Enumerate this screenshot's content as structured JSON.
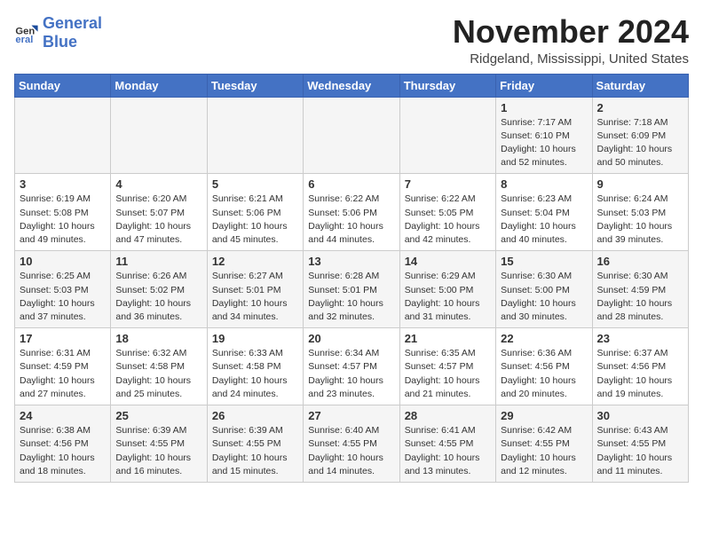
{
  "header": {
    "logo_general": "General",
    "logo_blue": "Blue",
    "month_title": "November 2024",
    "location": "Ridgeland, Mississippi, United States"
  },
  "calendar": {
    "days_of_week": [
      "Sunday",
      "Monday",
      "Tuesday",
      "Wednesday",
      "Thursday",
      "Friday",
      "Saturday"
    ],
    "weeks": [
      [
        {
          "day": "",
          "info": ""
        },
        {
          "day": "",
          "info": ""
        },
        {
          "day": "",
          "info": ""
        },
        {
          "day": "",
          "info": ""
        },
        {
          "day": "",
          "info": ""
        },
        {
          "day": "1",
          "info": "Sunrise: 7:17 AM\nSunset: 6:10 PM\nDaylight: 10 hours\nand 52 minutes."
        },
        {
          "day": "2",
          "info": "Sunrise: 7:18 AM\nSunset: 6:09 PM\nDaylight: 10 hours\nand 50 minutes."
        }
      ],
      [
        {
          "day": "3",
          "info": "Sunrise: 6:19 AM\nSunset: 5:08 PM\nDaylight: 10 hours\nand 49 minutes."
        },
        {
          "day": "4",
          "info": "Sunrise: 6:20 AM\nSunset: 5:07 PM\nDaylight: 10 hours\nand 47 minutes."
        },
        {
          "day": "5",
          "info": "Sunrise: 6:21 AM\nSunset: 5:06 PM\nDaylight: 10 hours\nand 45 minutes."
        },
        {
          "day": "6",
          "info": "Sunrise: 6:22 AM\nSunset: 5:06 PM\nDaylight: 10 hours\nand 44 minutes."
        },
        {
          "day": "7",
          "info": "Sunrise: 6:22 AM\nSunset: 5:05 PM\nDaylight: 10 hours\nand 42 minutes."
        },
        {
          "day": "8",
          "info": "Sunrise: 6:23 AM\nSunset: 5:04 PM\nDaylight: 10 hours\nand 40 minutes."
        },
        {
          "day": "9",
          "info": "Sunrise: 6:24 AM\nSunset: 5:03 PM\nDaylight: 10 hours\nand 39 minutes."
        }
      ],
      [
        {
          "day": "10",
          "info": "Sunrise: 6:25 AM\nSunset: 5:03 PM\nDaylight: 10 hours\nand 37 minutes."
        },
        {
          "day": "11",
          "info": "Sunrise: 6:26 AM\nSunset: 5:02 PM\nDaylight: 10 hours\nand 36 minutes."
        },
        {
          "day": "12",
          "info": "Sunrise: 6:27 AM\nSunset: 5:01 PM\nDaylight: 10 hours\nand 34 minutes."
        },
        {
          "day": "13",
          "info": "Sunrise: 6:28 AM\nSunset: 5:01 PM\nDaylight: 10 hours\nand 32 minutes."
        },
        {
          "day": "14",
          "info": "Sunrise: 6:29 AM\nSunset: 5:00 PM\nDaylight: 10 hours\nand 31 minutes."
        },
        {
          "day": "15",
          "info": "Sunrise: 6:30 AM\nSunset: 5:00 PM\nDaylight: 10 hours\nand 30 minutes."
        },
        {
          "day": "16",
          "info": "Sunrise: 6:30 AM\nSunset: 4:59 PM\nDaylight: 10 hours\nand 28 minutes."
        }
      ],
      [
        {
          "day": "17",
          "info": "Sunrise: 6:31 AM\nSunset: 4:59 PM\nDaylight: 10 hours\nand 27 minutes."
        },
        {
          "day": "18",
          "info": "Sunrise: 6:32 AM\nSunset: 4:58 PM\nDaylight: 10 hours\nand 25 minutes."
        },
        {
          "day": "19",
          "info": "Sunrise: 6:33 AM\nSunset: 4:58 PM\nDaylight: 10 hours\nand 24 minutes."
        },
        {
          "day": "20",
          "info": "Sunrise: 6:34 AM\nSunset: 4:57 PM\nDaylight: 10 hours\nand 23 minutes."
        },
        {
          "day": "21",
          "info": "Sunrise: 6:35 AM\nSunset: 4:57 PM\nDaylight: 10 hours\nand 21 minutes."
        },
        {
          "day": "22",
          "info": "Sunrise: 6:36 AM\nSunset: 4:56 PM\nDaylight: 10 hours\nand 20 minutes."
        },
        {
          "day": "23",
          "info": "Sunrise: 6:37 AM\nSunset: 4:56 PM\nDaylight: 10 hours\nand 19 minutes."
        }
      ],
      [
        {
          "day": "24",
          "info": "Sunrise: 6:38 AM\nSunset: 4:56 PM\nDaylight: 10 hours\nand 18 minutes."
        },
        {
          "day": "25",
          "info": "Sunrise: 6:39 AM\nSunset: 4:55 PM\nDaylight: 10 hours\nand 16 minutes."
        },
        {
          "day": "26",
          "info": "Sunrise: 6:39 AM\nSunset: 4:55 PM\nDaylight: 10 hours\nand 15 minutes."
        },
        {
          "day": "27",
          "info": "Sunrise: 6:40 AM\nSunset: 4:55 PM\nDaylight: 10 hours\nand 14 minutes."
        },
        {
          "day": "28",
          "info": "Sunrise: 6:41 AM\nSunset: 4:55 PM\nDaylight: 10 hours\nand 13 minutes."
        },
        {
          "day": "29",
          "info": "Sunrise: 6:42 AM\nSunset: 4:55 PM\nDaylight: 10 hours\nand 12 minutes."
        },
        {
          "day": "30",
          "info": "Sunrise: 6:43 AM\nSunset: 4:55 PM\nDaylight: 10 hours\nand 11 minutes."
        }
      ]
    ]
  }
}
